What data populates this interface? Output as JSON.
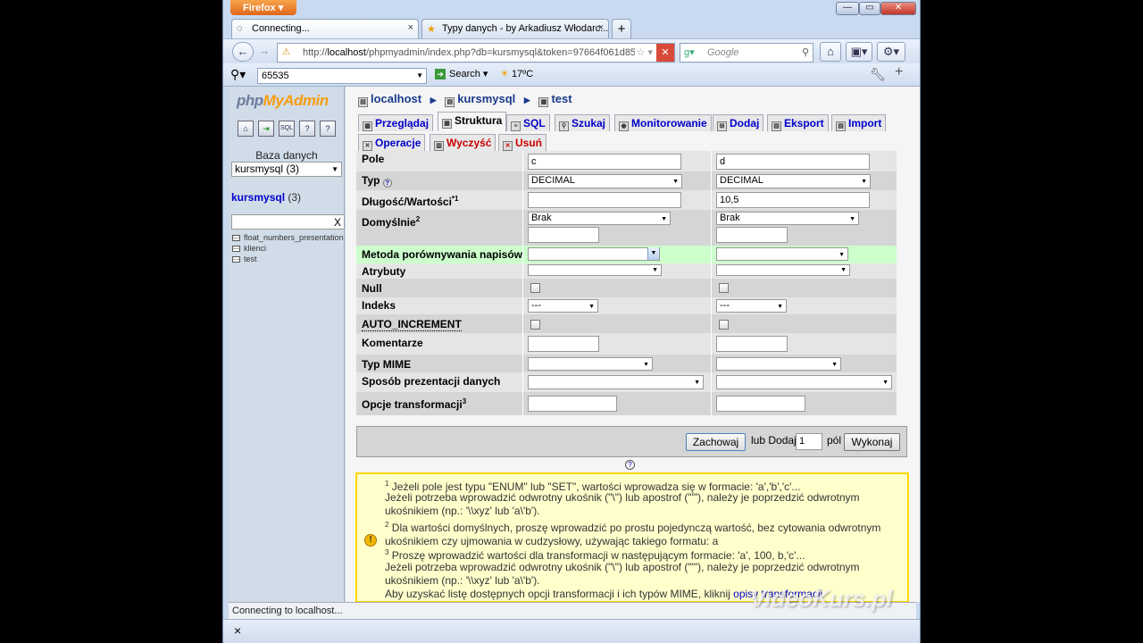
{
  "browser": {
    "menu_button": "Firefox",
    "window_controls": [
      "—",
      "▭",
      "✕"
    ],
    "tabs": [
      {
        "label": "Connecting...",
        "close": "×"
      },
      {
        "label": "Typy danych - by Arkadiusz Włodarc...",
        "close": "×"
      }
    ],
    "new_tab": "+",
    "url_prefix": "http://",
    "url_host": "localhost",
    "url_rest": "/phpmyadmin/index.php?db=kursmysql&token=97664f061d85b$",
    "search_placeholder": "Google",
    "search_toolbar": {
      "value": "65535",
      "search_label": "Search",
      "weather": "17ºC"
    },
    "status_text": "Connecting to localhost...",
    "findbar_close": "×",
    "watermark": "VideoKurs.pl"
  },
  "sidebar": {
    "logo_php": "php",
    "logo_myadmin": "MyAdmin",
    "icons": [
      "home-icon",
      "exit-icon",
      "sql-icon",
      "docs-icon",
      "help-icon"
    ],
    "icon_glyphs": [
      "⌂",
      "⇥",
      "SQL",
      "?",
      "?"
    ],
    "db_label": "Baza danych",
    "db_select": "kursmysql (3)",
    "db_name": "kursmysql",
    "db_count": "(3)",
    "filter_clear": "X",
    "tables": [
      "float_numbers_presentation",
      "klienci",
      "test"
    ]
  },
  "main": {
    "breadcrumb": {
      "server": "localhost",
      "db": "kursmysql",
      "table": "test"
    },
    "tabs": [
      {
        "label": "Przeglądaj",
        "icon": "browse-icon"
      },
      {
        "label": "Struktura",
        "icon": "structure-icon",
        "active": true
      },
      {
        "label": "SQL",
        "icon": "sql-icon"
      },
      {
        "label": "Szukaj",
        "icon": "search-icon"
      },
      {
        "label": "Monitorowanie",
        "icon": "tracking-icon"
      },
      {
        "label": "Dodaj",
        "icon": "insert-icon"
      },
      {
        "label": "Eksport",
        "icon": "export-icon"
      },
      {
        "label": "Import",
        "icon": "import-icon"
      }
    ],
    "tabs2": [
      {
        "label": "Operacje",
        "icon": "operations-icon"
      },
      {
        "label": "Wyczyść",
        "icon": "empty-icon"
      },
      {
        "label": "Usuń",
        "icon": "drop-icon"
      }
    ],
    "fields": {
      "labels": {
        "pole": "Pole",
        "typ": "Typ",
        "dlugosc": "Długość/Wartości",
        "dlugosc_sup": "*1",
        "domyslnie": "Domyślnie",
        "domyslnie_sup": "2",
        "metoda": "Metoda porównywania napisów",
        "atrybuty": "Atrybuty",
        "null": "Null",
        "indeks": "Indeks",
        "auto": "AUTO_INCREMENT",
        "komentarze": "Komentarze",
        "mime": "Typ MIME",
        "sposob": "Sposób prezentacji danych",
        "opcje": "Opcje transformacji",
        "opcje_sup": "3"
      },
      "columns": [
        {
          "name": "c",
          "type": "DECIMAL",
          "length": "",
          "default": "Brak",
          "index": "---"
        },
        {
          "name": "d",
          "type": "DECIMAL",
          "length": "10,5",
          "default": "Brak",
          "index": "---"
        }
      ]
    },
    "save_button": "Zachowaj",
    "or_add": "lub Dodaj",
    "add_count": "1",
    "fields_word": "pól",
    "go_button": "Wykonaj",
    "notes": {
      "n1_sup": "1",
      "n1": "Jeżeli pole jest typu \"ENUM\" lub \"SET\", wartości wprowadza się w formacie: 'a','b','c'...",
      "n1b": "Jeżeli potrzeba wprowadzić odwrotny ukośnik (\"\\\") lub apostrof (\"'\"), należy je poprzedzić odwrotnym ukośnikiem (np.: '\\\\xyz' lub 'a\\'b').",
      "n2_sup": "2",
      "n2": "Dla wartości domyślnych, proszę wprowadzić po prostu pojedynczą wartość, bez cytowania odwrotnym ukośnikiem czy ujmowania w cudzysłowy, używając takiego formatu: a",
      "n3_sup": "3",
      "n3": "Proszę wprowadzić wartości dla transformacji w następującym formacie: 'a', 100, b,'c'...",
      "n3b": "Jeżeli potrzeba wprowadzić odwrotny ukośnik (\"\\\") lub apostrof (\"'\"), należy je poprzedzić odwrotnym ukośnikiem (np.: '\\\\xyz' lub 'a\\'b').",
      "n4": "Aby uzyskać listę dostępnych opcji transformacji i ich typów MIME, kliknij",
      "n4_link": "opisy transformacji"
    }
  }
}
